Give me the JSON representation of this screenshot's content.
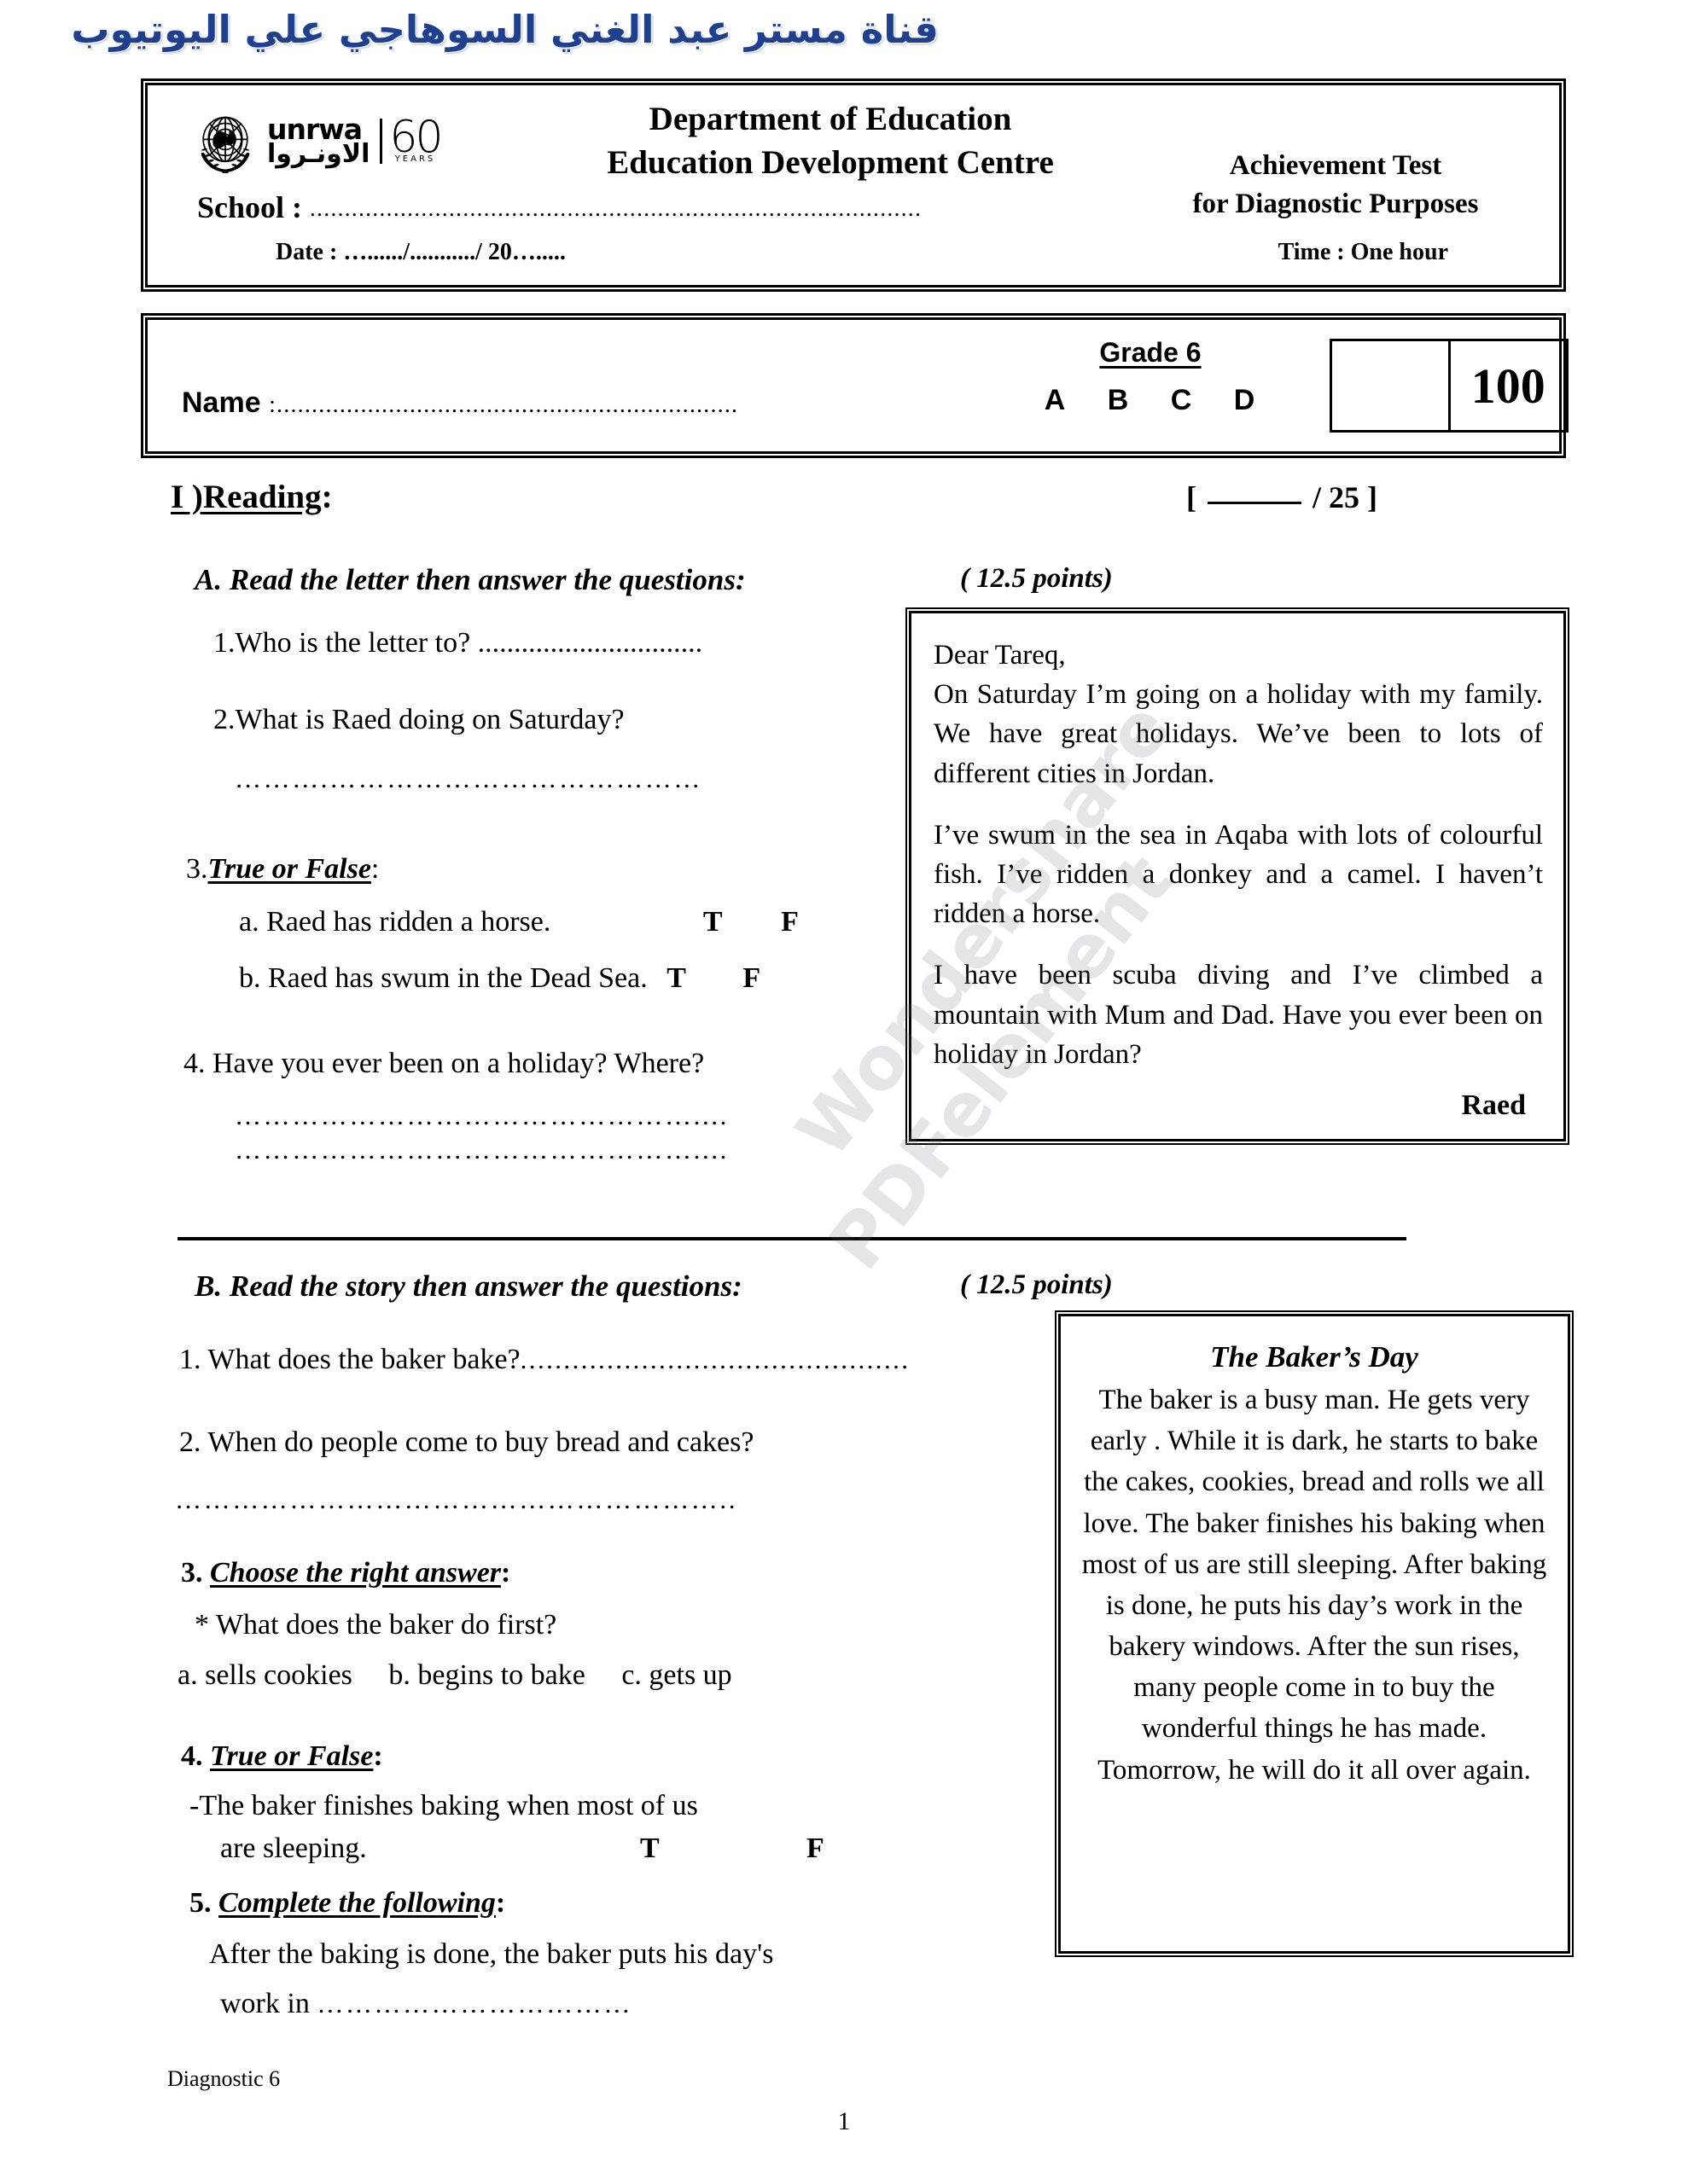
{
  "banner": {
    "arabic_text": "قناة مستر عبد الغني السوهاجي علي اليوتيوب"
  },
  "header": {
    "logo": {
      "unrwa_latin": "unrwa",
      "unrwa_arabic": "الاونـروا",
      "anniversary": "60",
      "anniversary_sub": "YEARS"
    },
    "department_line1": "Department of Education",
    "department_line2": "Education Development Centre",
    "achievement_line1": "Achievement Test",
    "achievement_line2": "for Diagnostic Purposes",
    "school_label": "School :",
    "school_dots": "........................................................................................",
    "date_label": "Date : …....../.........../ 20….....",
    "time_label": "Time :",
    "time_value": "One hour"
  },
  "name_box": {
    "name_label": "Name",
    "name_dots": ":..................................................................",
    "grade_title": "Grade 6",
    "grade_letters": [
      "A",
      "B",
      "C",
      "D"
    ],
    "score_total": "100"
  },
  "reading": {
    "section_number": "I )",
    "section_title": "Reading",
    "colon": ":",
    "marks_open": "[",
    "marks_denominator": "/ 25",
    "marks_close": "]"
  },
  "section_a": {
    "title": "A.  Read the letter then answer the questions:",
    "points": "( 12.5 points)",
    "q1": "1.Who is the letter to?  ...............................",
    "q2": "2.What  is Raed  doing on Saturday?",
    "q2_dots": "……….…………………………………",
    "q3_number": "3.",
    "q3_title": "True or False",
    "q3_colon": ":",
    "q3a": "a. Raed has ridden a horse.",
    "q3a_t": "T",
    "q3a_f": "F",
    "q3b": "b. Raed has swum in the Dead Sea.",
    "q3b_t": "T",
    "q3b_f": "F",
    "q4": "4. Have you ever been on a holiday? Where?",
    "q4_dots_line1": "…………………………………………....",
    "q4_dots_line2": "…………………………………………....",
    "letter": {
      "salutation": "Dear Tareq,",
      "para1": "On Saturday I’m going on a holiday with my family. We have great holidays. We’ve been to lots of different cities in Jordan.",
      "para2": "I’ve swum in the sea in Aqaba with lots of colourful fish. I’ve ridden a donkey and a camel. I haven’t ridden a horse.",
      "para3": "I have been scuba diving and I’ve climbed a mountain with Mum and Dad. Have you ever been on holiday in Jordan?",
      "signature": "Raed"
    }
  },
  "section_b": {
    "title": "B.  Read the story then answer the questions:",
    "points": "( 12.5 points)",
    "q1": "1. What does the baker bake?",
    "q1_dots": ".............................................",
    "q2": "2. When do people come to buy bread and cakes?",
    "q2_dots": "…………………………………………………..",
    "q3_number": "3.",
    "q3_title": "Choose the right answer",
    "q3_colon": ":",
    "q3_stem": "* What does the baker do first?",
    "q3_options": [
      "a. sells cookies",
      "b. begins to bake",
      "c.  gets up"
    ],
    "q4_number": "4.",
    "q4_title": "True or False",
    "q4_colon": ":",
    "q4_stem_line1": "-The baker finishes baking when most of us",
    "q4_stem_line2": "are sleeping.",
    "q4_t": "T",
    "q4_f": "F",
    "q5_number": "5.",
    "q5_title": "Complete the following",
    "q5_colon": ":",
    "q5_line1": "After the baking is done, the baker puts his day's",
    "q5_line2": "work in",
    "q5_dots": "……………………………",
    "story": {
      "title": "The Baker’s Day",
      "body": "The baker is a busy man. He gets very early . While it is dark, he starts to bake the cakes, cookies, bread and rolls we all love. The baker finishes his baking when most of us are still sleeping. After baking is done, he puts his day’s work in the bakery windows. After the sun rises, many people come in to buy the wonderful things he has made. Tomorrow, he will do it all over again."
    }
  },
  "footer": {
    "left_label": "Diagnostic 6",
    "page_number": "1"
  },
  "watermark": {
    "line1": "Wondershare",
    "line2": "PDFelement"
  },
  "colors": {
    "banner_blue": "#1f3f8f",
    "ink": "#000000",
    "paper": "#ffffff"
  }
}
